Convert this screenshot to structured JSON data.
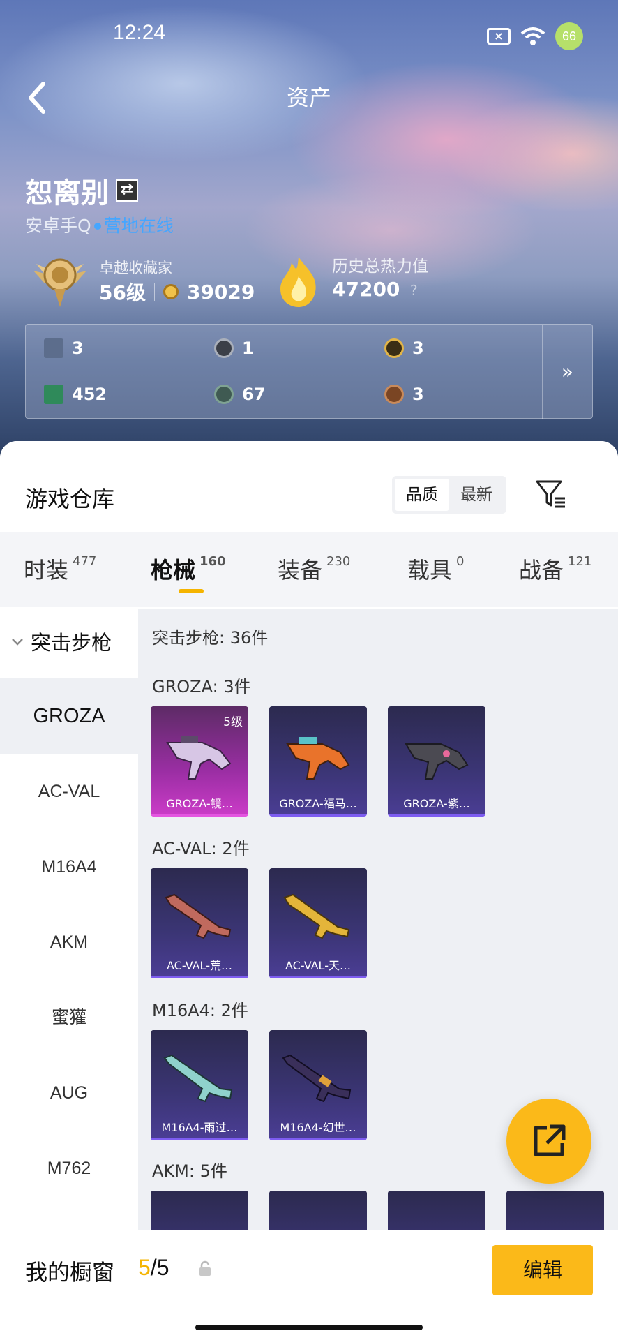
{
  "status_bar": {
    "time": "12:24",
    "battery": "66"
  },
  "header": {
    "title": "资产"
  },
  "profile": {
    "name": "恕离别",
    "platform": "安卓手Q",
    "online_status": "营地在线",
    "rank_title": "卓越收藏家",
    "level": "56级",
    "coins": "39029",
    "heat_title": "历史总热力值",
    "heat_value": "47200",
    "heat_help": "?"
  },
  "stats": [
    {
      "icon": "card-icon",
      "value": "3"
    },
    {
      "icon": "silver-coin-icon",
      "value": "1"
    },
    {
      "icon": "gold-token-icon",
      "value": "3"
    },
    {
      "icon": "green-card-icon",
      "value": "452"
    },
    {
      "icon": "green-coin-icon",
      "value": "67"
    },
    {
      "icon": "bronze-token-icon",
      "value": "3"
    }
  ],
  "stats_more": "»",
  "warehouse": {
    "title": "游戏仓库",
    "sort_options": [
      "品质",
      "最新"
    ],
    "active_sort": "品质"
  },
  "tabs": [
    {
      "label": "时装",
      "count": "477"
    },
    {
      "label": "枪械",
      "count": "160"
    },
    {
      "label": "装备",
      "count": "230"
    },
    {
      "label": "载具",
      "count": "0"
    },
    {
      "label": "战备",
      "count": "121"
    }
  ],
  "active_tab": "枪械",
  "sidebar": {
    "category": "突击步枪",
    "items": [
      "GROZA",
      "AC-VAL",
      "M16A4",
      "AKM",
      "蜜獾",
      "AUG",
      "M762"
    ],
    "active": "GROZA"
  },
  "content": {
    "summary": "突击步枪: 36件",
    "groups": [
      {
        "title": "GROZA: 3件",
        "cards": [
          {
            "label": "GROZA-镜…",
            "level": "5级",
            "rarity": "legendary"
          },
          {
            "label": "GROZA-福马…",
            "rarity": "epic"
          },
          {
            "label": "GROZA-紫…",
            "rarity": "epic"
          }
        ]
      },
      {
        "title": "AC-VAL: 2件",
        "cards": [
          {
            "label": "AC-VAL-荒…",
            "rarity": "epic"
          },
          {
            "label": "AC-VAL-天…",
            "rarity": "epic"
          }
        ]
      },
      {
        "title": "M16A4: 2件",
        "cards": [
          {
            "label": "M16A4-雨过…",
            "rarity": "epic"
          },
          {
            "label": "M16A4-幻世…",
            "rarity": "epic"
          }
        ]
      },
      {
        "title": "AKM: 5件"
      }
    ]
  },
  "showcase": {
    "label": "我的橱窗",
    "current": "5",
    "total": "/5"
  },
  "edit_button": "编辑",
  "colors": {
    "accent": "#fbb919",
    "online": "#45a6ff",
    "legendary": "#c93bc6",
    "epic": "#4a3d93"
  }
}
